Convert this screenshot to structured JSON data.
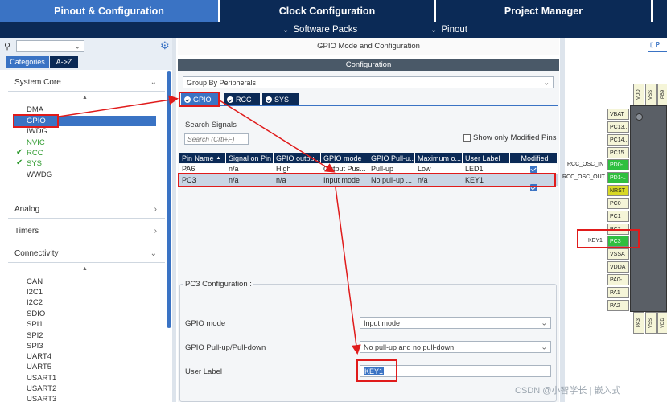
{
  "top_tabs": {
    "pinout": "Pinout & Configuration",
    "clock": "Clock Configuration",
    "project": "Project Manager"
  },
  "sub_menu": {
    "software_packs": "Software Packs",
    "pinout": "Pinout"
  },
  "left": {
    "tab_categories": "Categories",
    "tab_az": "A->Z",
    "system_core_title": "System Core",
    "system_core_items": [
      "DMA",
      "GPIO",
      "IWDG",
      "NVIC",
      "RCC",
      "SYS",
      "WWDG"
    ],
    "analog": "Analog",
    "timers": "Timers",
    "connectivity": "Connectivity",
    "connectivity_items": [
      "CAN",
      "I2C1",
      "I2C2",
      "SDIO",
      "SPI1",
      "SPI2",
      "SPI3",
      "UART4",
      "UART5",
      "USART1",
      "USART2",
      "USART3"
    ]
  },
  "middle": {
    "title": "GPIO Mode and Configuration",
    "config_bar": "Configuration",
    "group_by": "Group By Peripherals",
    "tabs": [
      "GPIO",
      "RCC",
      "SYS"
    ],
    "search_label": "Search Signals",
    "search_placeholder": "Search (Crtl+F)",
    "show_modified": "Show only Modified Pins",
    "table_headers": [
      "Pin Name",
      "Signal on Pin",
      "GPIO outpu...",
      "GPIO mode",
      "GPIO Pull-u...",
      "Maximum o...",
      "User Label",
      "Modified"
    ],
    "rows": [
      [
        "PA6",
        "n/a",
        "High",
        "Output Pus...",
        "Pull-up",
        "Low",
        "LED1"
      ],
      [
        "PC3",
        "n/a",
        "n/a",
        "Input mode",
        "No pull-up ...",
        "n/a",
        "KEY1"
      ]
    ],
    "pc3_config_title": "PC3 Configuration :",
    "gpio_mode_label": "GPIO mode",
    "gpio_mode_value": "Input mode",
    "pull_label": "GPIO Pull-up/Pull-down",
    "pull_value": "No pull-up and no pull-down",
    "user_label_label": "User Label",
    "user_label_value": "KEY1"
  },
  "right": {
    "top_pins": [
      "VDD",
      "VSS",
      "PB9"
    ],
    "left_pins": [
      "VBAT",
      "PC13..",
      "PC14..",
      "PC15..",
      "PD0-..",
      "PD1-..",
      "NRST",
      "PC0",
      "PC1",
      "PC2",
      "PC3",
      "VSSA",
      "VDDA",
      "PA0-..",
      "PA1",
      "PA2"
    ],
    "bottom_pins": [
      "PA3",
      "VSS",
      "VDD"
    ],
    "labels": {
      "osc_in": "RCC_OSC_IN",
      "osc_out": "RCC_OSC_OUT",
      "key1": "KEY1"
    }
  },
  "watermark": "CSDN @小智学长 | 嵌入式"
}
